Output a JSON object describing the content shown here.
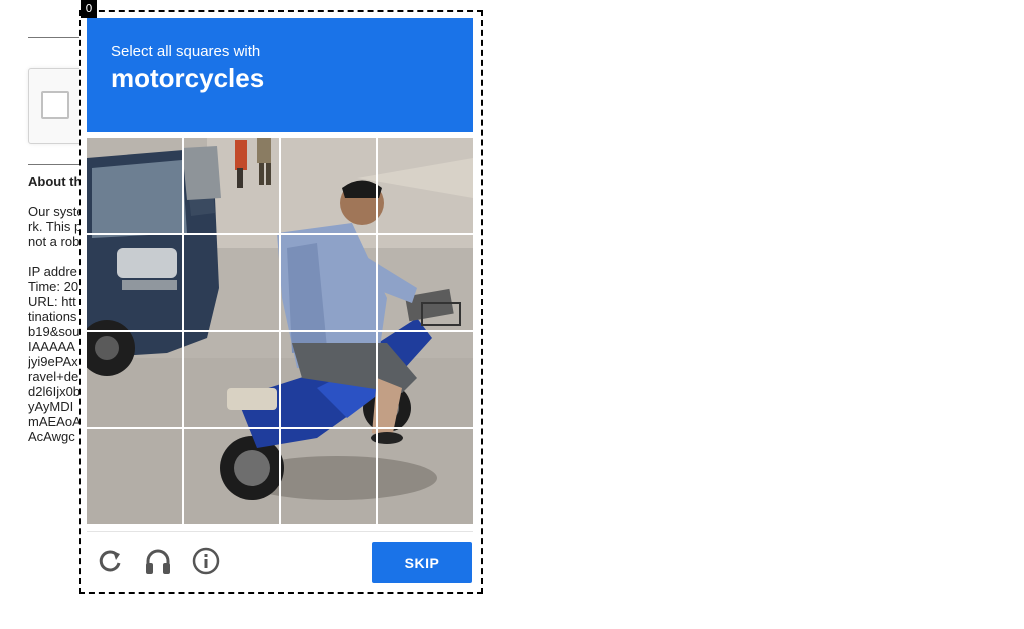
{
  "focus_badge": "0",
  "challenge": {
    "instruction": "Select all squares with",
    "target": "motorcycles",
    "skip_label": "SKIP",
    "colors": {
      "header_bg": "#1a73e8",
      "button_bg": "#1a73e8",
      "icon": "#555555"
    },
    "footer_icons": [
      "reload-icon",
      "audio-headphones-icon",
      "info-icon"
    ],
    "grid": {
      "rows": 4,
      "cols": 4
    }
  },
  "about": {
    "title": "About th",
    "lines": [
      "Our syste",
      "rk. This p",
      "not a rob",
      "",
      "IP addre",
      "Time: 20",
      "URL: htt",
      "tinations",
      "b19&sou",
      "IAAAAA",
      "jyi9ePAx",
      "ravel+de",
      "d2l6Ijx0b",
      "yAyMDI",
      "mAEAoA",
      "AcAwgc"
    ]
  }
}
